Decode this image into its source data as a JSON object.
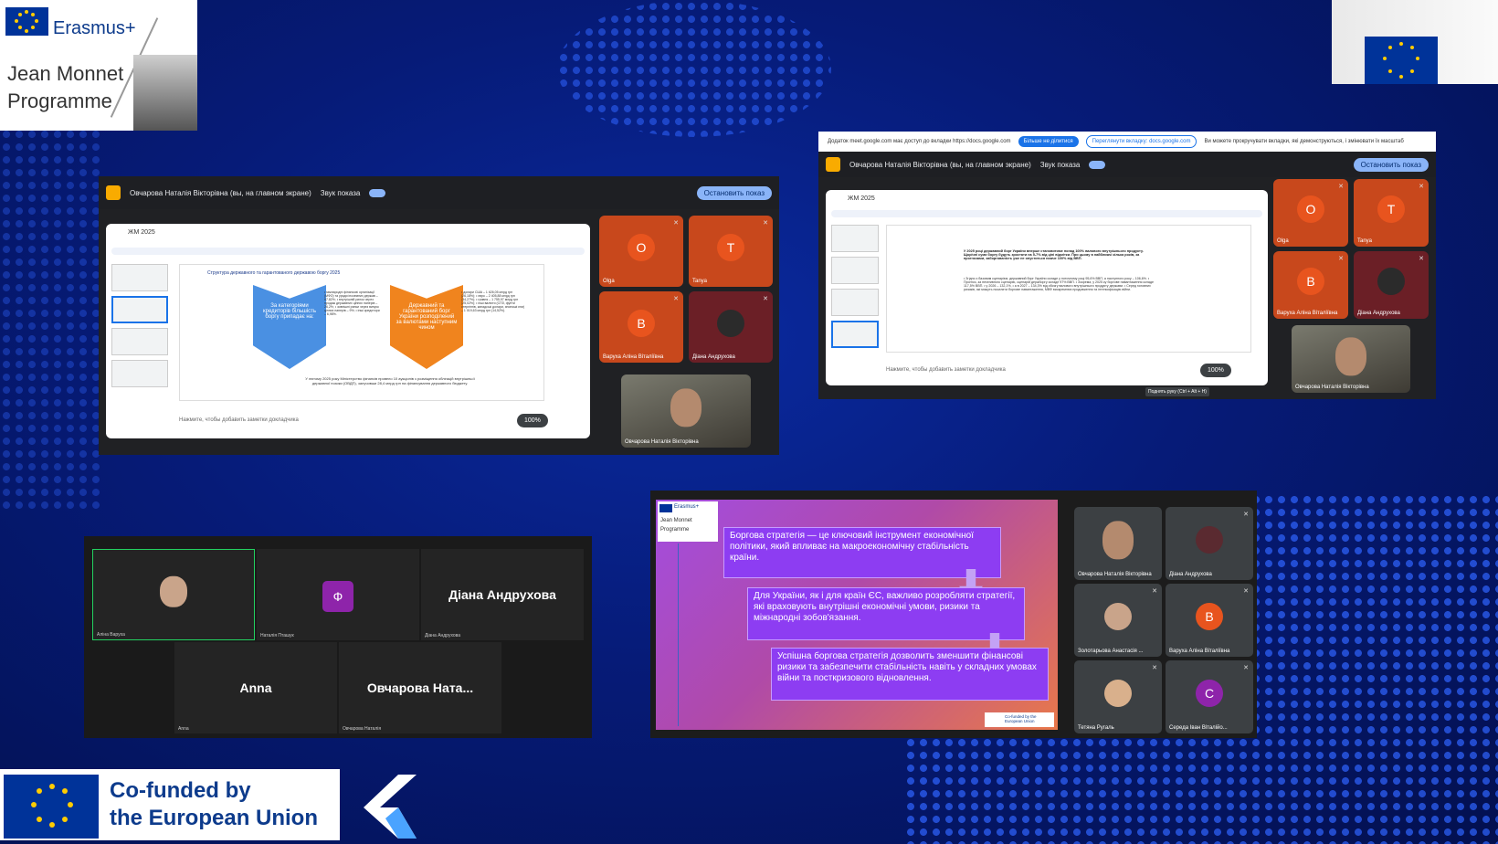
{
  "branding": {
    "erasmus": "Erasmus+",
    "jean_monnet_line1": "Jean Monnet",
    "jean_monnet_line2": "Programme",
    "cofunded_line1": "Co-funded by",
    "cofunded_line2": "the European Union"
  },
  "meet1": {
    "presenter_label": "Овчарова Наталія Вікторівна (вы, на главном экране)",
    "sound_label": "Звук показа",
    "stop_label": "Остановить показ",
    "doc_title": "ЖМ 2025",
    "slide_title": "Структура державного та гарантованого державою боргу 2025",
    "chevron1": "За категоріями кредиторів більшість боргу припадає на:",
    "chevron2": "Державний та гарантований борг України розподілений за валютами наступним чином",
    "list1": "• міжнародні фінансові організації (МФО) та уряди іноземних держав – 67,82%; • внутрішній ринок через продаж державних цінних паперів – 26,2%; • зовнішні ринки через випуск цінних паперів – 9%; • інші кредитори – 6,98%.",
    "list2": "• долари США – 1 626,05 млрд грн (26,18%); • євро – 2 405,88 млрд грн (34,27%); • гривня – 1 755,97 млрд грн (25,02%); • інші валюти (СПЗ, фунти стерлінгів, канадські долари, японські єни) – 1 019,63 млрд грн (14,52%).",
    "bottom_text": "У лютому 2025 року Міністерство фінансів провело 10 аукціонів з розміщення облігацій внутрішньої державної позики (ОВДП), залучивши 28,4 млрд грн на фінансування державного бюджету.",
    "notes": "Нажмите, чтобы добавить заметки докладчика",
    "zoom": "100%",
    "tiles": [
      {
        "initial": "O",
        "name": "Olga"
      },
      {
        "initial": "T",
        "name": "Tanya"
      },
      {
        "initial": "B",
        "name": "Варуха Аліна Віталіївна"
      },
      {
        "initial": "",
        "name": "Діана Андрухова"
      }
    ],
    "self_name": "Овчарова Наталія Вікторівна"
  },
  "meet2": {
    "access_notice": "Додаток meet.google.com має доступ до вкладки https://docs.google.com",
    "stop_sharing": "Більше не ділитися",
    "switch_tab": "Переглянути вкладку: docs.google.com",
    "scroll_notice": "Ви можете прокручувати вкладки, які демонструються, і змінювати їх масштаб",
    "presenter_label": "Овчарова Наталія Вікторівна (вы, на главном экране)",
    "sound_label": "Звук показа",
    "stop_label": "Остановить показ",
    "doc_title": "ЖМ 2025",
    "slide_lead": "У 2025 році державний борг України вперше становитиме понад 100% валового внутрішнього продукту. Щорічні суми боргу будуть зростати на 5-7% від ціні відмітки. При цьому в найближчі кілька років, за прогнозами, заборгованість уже не опуститься нижче 100% від ВВП.",
    "slide_body": "• Згідно з базовим сценарієм, державний борг України складе у поточному році 95,6% ВВП, а наступного року – 106,6%. • Прогноз, за негативного сценарію, сценарій держборгу складе 97% ВВП. • Зокрема, у 2025 ку борговe навантаження складе 117,5% ВВП. • у 2026 – 132,1%, • а в 2027 – 134,3% від обсягу валового внутрішнього продукту держави. • Серед головних ризиків, які можуть посилити боргове навантаження, МВФ виокремлює продовження та інтенсифікацію війни.",
    "notes": "Нажмите, чтобы добавить заметки докладчика",
    "zoom": "100%",
    "tooltip": "Поднять руку (Ctrl + Alt + H)",
    "tiles": [
      {
        "initial": "O",
        "name": "Olga"
      },
      {
        "initial": "T",
        "name": "Tanya"
      },
      {
        "initial": "B",
        "name": "Варуха Аліна Віталіївна"
      },
      {
        "initial": "",
        "name": "Діана Андрухова"
      }
    ],
    "self_name": "Овчарова Наталія Вікторівна"
  },
  "zoom_gallery": {
    "tiles": [
      {
        "name": "Аліна Варуха",
        "big": ""
      },
      {
        "name": "Наталія Пташук",
        "big": "",
        "initial": "Ф"
      },
      {
        "name": "Діана Андрухова",
        "big": "Діана Андрухова"
      },
      {
        "name": "Anna",
        "big": "Anna"
      },
      {
        "name": "Овчарова Наталія",
        "big": "Овчарова  Ната..."
      }
    ]
  },
  "presentation": {
    "box1": "Боргова стратегія — це ключовий інструмент економічної політики, який впливає на макроекономічну стабільність країни.",
    "box2": "Для України, як і для країн ЄС, важливо розробляти стратегії, які враховують внутрішні економічні умови, ризики та міжнародні зобов'язання.",
    "box3": "Успішна боргова стратегія дозволить зменшити фінансові ризики та забезпечити стабільність навіть у складних умовах війни та посткризового відновлення.",
    "footer": "Co-funded by the European Union",
    "tiles": [
      {
        "name": "Овчарова Наталія Вікторівна",
        "initial": ""
      },
      {
        "name": "Діана Андрухова",
        "initial": ""
      },
      {
        "name": "Золотарьова Анастасія ...",
        "initial": ""
      },
      {
        "name": "Варуха Аліна Віталіївна",
        "initial": "B"
      },
      {
        "name": "Тетяна Ругаль",
        "initial": ""
      },
      {
        "name": "Середа Іван Віталійо...",
        "initial": "C"
      }
    ]
  },
  "colors": {
    "eu_blue": "#003399",
    "avatar_orange": "#e8541e",
    "avatar_purple": "#8e24aa",
    "meet_accent": "#8ab4f8"
  }
}
